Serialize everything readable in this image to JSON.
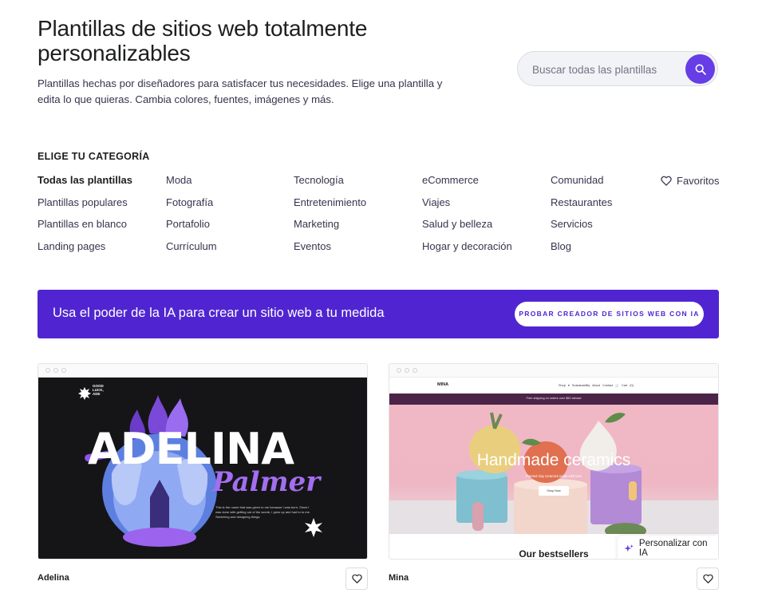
{
  "header": {
    "title": "Plantillas de sitios web totalmente personalizables",
    "subtitle": "Plantillas hechas por diseñadores para satisfacer tus necesidades. Elige una plantilla y edita lo que quieras. Cambia colores, fuentes, imágenes y más."
  },
  "search": {
    "placeholder": "Buscar todas las plantillas",
    "icon": "search-icon"
  },
  "categories": {
    "heading": "ELIGE TU CATEGORÍA",
    "columns": [
      [
        "Todas las plantillas",
        "Plantillas populares",
        "Plantillas en blanco",
        "Landing pages"
      ],
      [
        "Moda",
        "Fotografía",
        "Portafolio",
        "Currículum"
      ],
      [
        "Tecnología",
        "Entretenimiento",
        "Marketing",
        "Eventos"
      ],
      [
        "eCommerce",
        "Viajes",
        "Salud y belleza",
        "Hogar y decoración"
      ],
      [
        "Comunidad",
        "Restaurantes",
        "Servicios",
        "Blog"
      ]
    ],
    "active": "Todas las plantillas",
    "favorites": "Favoritos"
  },
  "banner": {
    "text": "Usa el poder de la IA para crear un sitio web a tu medida",
    "button": "PROBAR CREADOR DE SITIOS WEB CON IA"
  },
  "templates": [
    {
      "name": "Adelina",
      "preview": {
        "logo": "GOOD LUCK, ADE",
        "headline": "ADELINA",
        "script": "Palmer",
        "body": "This is the name that was given to me because I was born. Since I was done with getting out of the womb, I grew up and had to to me. Sketching and designing things."
      }
    },
    {
      "name": "Mina",
      "preview": {
        "logo": "MINA",
        "nav": "Shop ▾   Sustainability   About   Contact   🛒 Cart (0)",
        "strip": "Free shipping on orders over $50 abroad",
        "headline": "Handmade ceramics",
        "tagline": "Painted clay ceramics made with love",
        "shop_button": "Shop Now",
        "section": "Our bestsellers"
      },
      "ai_chip": "Personalizar con IA"
    }
  ],
  "colors": {
    "accent": "#673de6",
    "banner": "#5025d1",
    "text": "#1d1e20"
  }
}
